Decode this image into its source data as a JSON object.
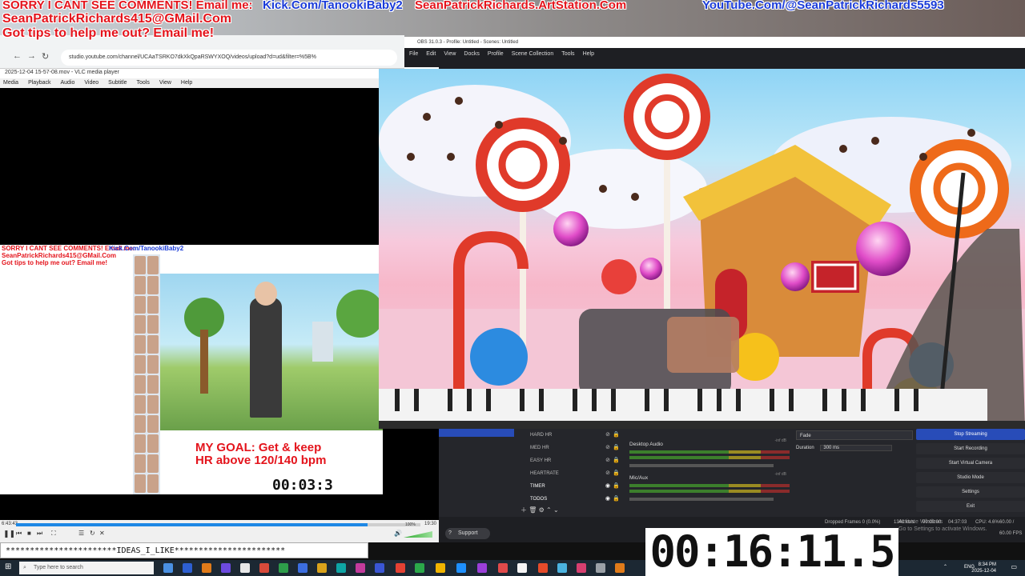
{
  "banners": {
    "line1_red": "SORRY I CANT SEE COMMENTS! Email me:",
    "line1_blue_kick": "Kick.Com/TanookiBaby2",
    "line1_red_artstation": "SeanPatrickRichards.ArtStation.Com",
    "line1_blue_youtube": "YouTube.Com/@SeanPatrickRichards5593",
    "line2_red": "SeanPatrickRichards415@GMail.Com",
    "line3_red": "Got tips to help me out? Email me!"
  },
  "browser": {
    "url": "studio.youtube.com/channel/UCAaTSRKO7dkXkQpaRSWYXOQ/videos/upload?d=ud&filter=%5B%"
  },
  "vlc": {
    "title": "2025-12-04 15-57-08.mov - VLC media player",
    "menu": [
      "Media",
      "Playback",
      "Audio",
      "Video",
      "Subtitle",
      "Tools",
      "View",
      "Help"
    ],
    "time_elapsed": "6:43:43",
    "time_total": "19:30",
    "progress": 0.87,
    "volume": "100%"
  },
  "nested": {
    "goal_line1": "MY GOAL: Get & keep",
    "goal_line2": "HR above 120/140 bpm",
    "small_timer": "00:03:3"
  },
  "bottom_note": "***********************IDEAS_I_LIKE***********************",
  "obs": {
    "title": "OBS 31.0.3 - Profile: Untitled - Scenes: Untitled",
    "menu": [
      "File",
      "Edit",
      "View",
      "Docks",
      "Profile",
      "Scene Collection",
      "Tools",
      "Help"
    ],
    "sources": [
      {
        "label": "HARD HR",
        "active": false
      },
      {
        "label": "MED HR",
        "active": false
      },
      {
        "label": "EASY HR",
        "active": false
      },
      {
        "label": "HEARTRATE",
        "active": false
      },
      {
        "label": "TIMER",
        "active": true
      },
      {
        "label": "TODOS",
        "active": true
      }
    ],
    "mixer": [
      {
        "name": "Desktop Audio",
        "db": "-inf dB"
      },
      {
        "name": "Mic/Aux",
        "db": "-inf dB"
      }
    ],
    "transition": "Fade",
    "duration_label": "Duration",
    "duration_value": "300 ms",
    "controls": [
      "Stop Streaming",
      "Start Recording",
      "Start Virtual Camera",
      "Studio Mode",
      "Settings",
      "Exit"
    ],
    "status": {
      "dropped": "Dropped Frames 0 (0.0%)",
      "kbps": "1340 kb/s",
      "live": "00:00:00",
      "rec": "04:37:03",
      "cpu": "CPU: 4.6%",
      "fps": "60.00 / 60.00 FPS"
    },
    "support_label": "Support"
  },
  "watermark": {
    "line1": "Activate Windows",
    "line2": "Go to Settings to activate Windows."
  },
  "big_timer": "00:16:11.5",
  "taskbar": {
    "search_placeholder": "Type here to search",
    "lang": "ENG",
    "time": "8:34 PM",
    "date": "2025-12-04"
  },
  "colors": {
    "banner_red": "#e4141c",
    "banner_blue": "#1a3bd8",
    "obs_active": "#284cb8"
  }
}
